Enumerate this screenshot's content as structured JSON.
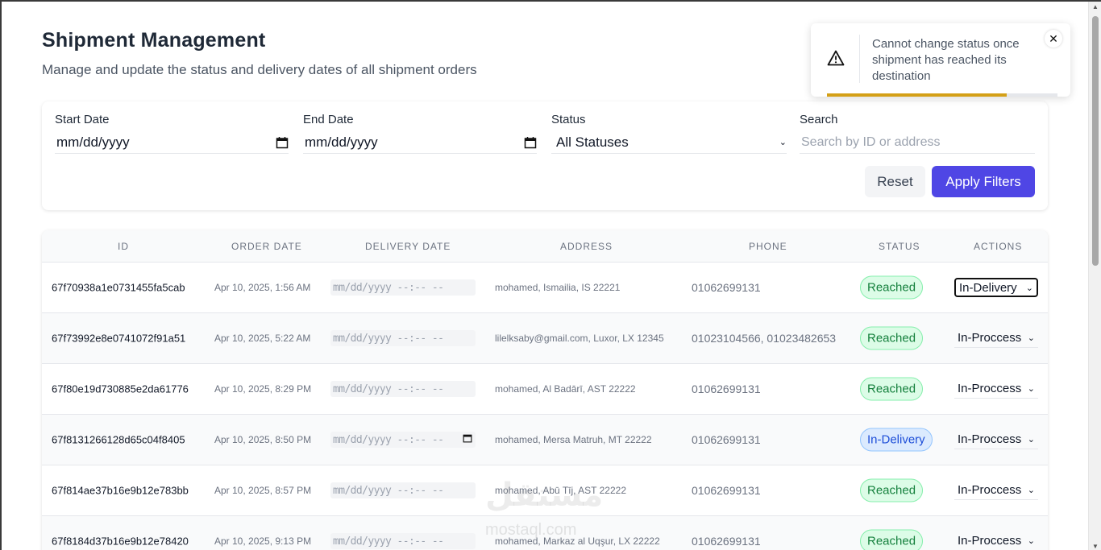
{
  "header": {
    "title": "Shipment Management",
    "subtitle": "Manage and update the status and delivery dates of all shipment orders"
  },
  "filters": {
    "start_date_label": "Start Date",
    "start_date_value": "mm/dd/yyyy",
    "end_date_label": "End Date",
    "end_date_value": "mm/dd/yyyy",
    "status_label": "Status",
    "status_value": "All Statuses",
    "search_label": "Search",
    "search_placeholder": "Search by ID or address",
    "reset_label": "Reset",
    "apply_label": "Apply Filters"
  },
  "table": {
    "columns": [
      "ID",
      "ORDER DATE",
      "DELIVERY DATE",
      "ADDRESS",
      "PHONE",
      "STATUS",
      "ACTIONS"
    ],
    "delivery_placeholder": "mm/dd/yyyy --:-- --",
    "rows": [
      {
        "id": "67f70938a1e0731455fa5cab",
        "order_date": "Apr 10, 2025, 1:56 AM",
        "address": "mohamed, Ismailia, IS 22221",
        "phone": "01062699131",
        "status": "Reached",
        "action": "In-Delivery"
      },
      {
        "id": "67f73992e8e0741072f91a51",
        "order_date": "Apr 10, 2025, 5:22 AM",
        "address": "lilelksaby@gmail.com, Luxor, LX 12345",
        "phone": "01023104566, 01023482653",
        "status": "Reached",
        "action": "In-Proccess"
      },
      {
        "id": "67f80e19d730885e2da61776",
        "order_date": "Apr 10, 2025, 8:29 PM",
        "address": "mohamed, Al Badārī, AST 22222",
        "phone": "01062699131",
        "status": "Reached",
        "action": "In-Proccess"
      },
      {
        "id": "67f8131266128d65c04f8405",
        "order_date": "Apr 10, 2025, 8:50 PM",
        "address": "mohamed, Mersa Matruh, MT 22222",
        "phone": "01062699131",
        "status": "In-Delivery",
        "action": "In-Proccess"
      },
      {
        "id": "67f814ae37b16e9b12e783bb",
        "order_date": "Apr 10, 2025, 8:57 PM",
        "address": "mohamed, Abū Tīj, AST 22222",
        "phone": "01062699131",
        "status": "Reached",
        "action": "In-Proccess"
      },
      {
        "id": "67f8184d37b16e9b12e78420",
        "order_date": "Apr 10, 2025, 9:13 PM",
        "address": "mohamed, Markaz al Uqşur, LX 22222",
        "phone": "01062699131",
        "status": "Reached",
        "action": "In-Proccess"
      }
    ]
  },
  "toast": {
    "message": "Cannot change status once shipment has reached its destination",
    "close_symbol": "✕",
    "progress": 0.78,
    "accent": "#d4a017"
  },
  "watermark": {
    "text": "مستقل",
    "url": "mostaql.com"
  },
  "colors": {
    "primary": "#4f46e5",
    "reached_bg": "#dcfce7",
    "reached_text": "#15803d",
    "delivery_bg": "#dbeafe",
    "delivery_text": "#1d4ed8"
  }
}
